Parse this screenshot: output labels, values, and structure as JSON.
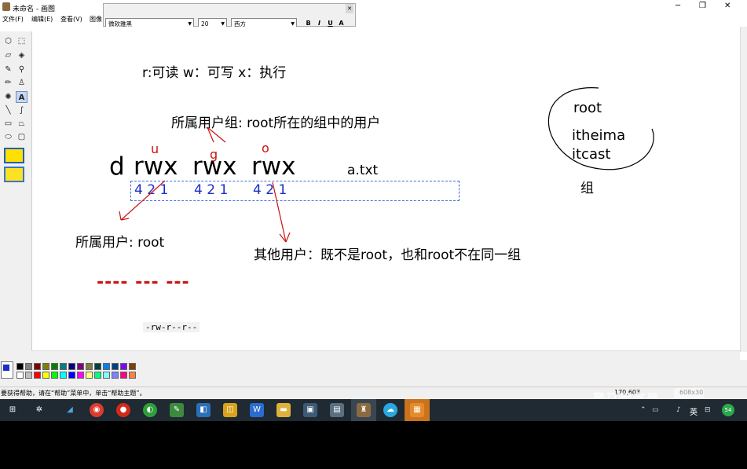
{
  "titlebar": {
    "title": "未命名 - 画图",
    "font_panel_title": "字体",
    "controls": {
      "minimize": "─",
      "maximize": "❐",
      "close": "✕"
    }
  },
  "menu": [
    "文件(F)",
    "编辑(E)",
    "查看(V)",
    "图像"
  ],
  "fontbar": {
    "font_name": "微软雅黑",
    "font_size": "20",
    "script": "西方",
    "bold": "B",
    "italic": "I",
    "underline": "U",
    "vertical": "A",
    "close": "✕"
  },
  "canvas": {
    "legend": "r:可读  w：可写   x：执行",
    "group_note": "所属用户组: root所在的组中的用户",
    "label_u": "u",
    "label_g": "g",
    "label_o": "o",
    "d": "d",
    "perm1": "rwx",
    "perm2": "rwx",
    "perm3": "rwx",
    "filename": "a.txt",
    "digits1": "4 2  1",
    "digits2": "4 2 1",
    "digits3": "4 2  1",
    "owner_note": "所属用户: root",
    "other_note": "其他用户：既不是root，也和root不在同一组",
    "dashes": "---- ---  ---",
    "perm_example": "-rw-r--r--",
    "circle_users": [
      "root",
      "itheima",
      "itcast"
    ],
    "group_label": "组"
  },
  "statusbar": {
    "help": "要获得帮助，请在“帮助”菜单中，单击“帮助主题”。",
    "coords": "170,603",
    "size": "608x30"
  },
  "watermark": "黑马程序员",
  "taskbar": {
    "badge": "54",
    "ime": "英"
  },
  "colors": {
    "annotation_red": "#cc1111",
    "digits_blue": "#1a2fc8",
    "taskbar": "#1f2a33"
  }
}
